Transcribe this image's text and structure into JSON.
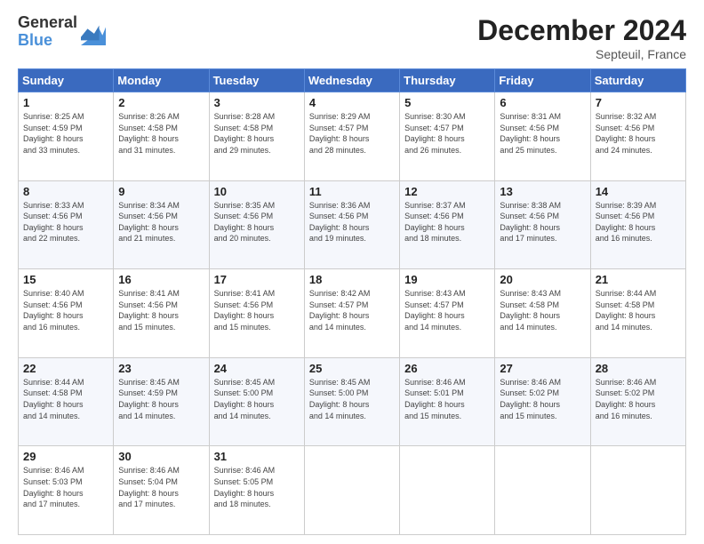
{
  "header": {
    "logo_line1": "General",
    "logo_line2": "Blue",
    "month": "December 2024",
    "location": "Septeuil, France"
  },
  "weekdays": [
    "Sunday",
    "Monday",
    "Tuesday",
    "Wednesday",
    "Thursday",
    "Friday",
    "Saturday"
  ],
  "weeks": [
    [
      {
        "day": "1",
        "lines": [
          "Sunrise: 8:25 AM",
          "Sunset: 4:59 PM",
          "Daylight: 8 hours",
          "and 33 minutes."
        ]
      },
      {
        "day": "2",
        "lines": [
          "Sunrise: 8:26 AM",
          "Sunset: 4:58 PM",
          "Daylight: 8 hours",
          "and 31 minutes."
        ]
      },
      {
        "day": "3",
        "lines": [
          "Sunrise: 8:28 AM",
          "Sunset: 4:58 PM",
          "Daylight: 8 hours",
          "and 29 minutes."
        ]
      },
      {
        "day": "4",
        "lines": [
          "Sunrise: 8:29 AM",
          "Sunset: 4:57 PM",
          "Daylight: 8 hours",
          "and 28 minutes."
        ]
      },
      {
        "day": "5",
        "lines": [
          "Sunrise: 8:30 AM",
          "Sunset: 4:57 PM",
          "Daylight: 8 hours",
          "and 26 minutes."
        ]
      },
      {
        "day": "6",
        "lines": [
          "Sunrise: 8:31 AM",
          "Sunset: 4:56 PM",
          "Daylight: 8 hours",
          "and 25 minutes."
        ]
      },
      {
        "day": "7",
        "lines": [
          "Sunrise: 8:32 AM",
          "Sunset: 4:56 PM",
          "Daylight: 8 hours",
          "and 24 minutes."
        ]
      }
    ],
    [
      {
        "day": "8",
        "lines": [
          "Sunrise: 8:33 AM",
          "Sunset: 4:56 PM",
          "Daylight: 8 hours",
          "and 22 minutes."
        ]
      },
      {
        "day": "9",
        "lines": [
          "Sunrise: 8:34 AM",
          "Sunset: 4:56 PM",
          "Daylight: 8 hours",
          "and 21 minutes."
        ]
      },
      {
        "day": "10",
        "lines": [
          "Sunrise: 8:35 AM",
          "Sunset: 4:56 PM",
          "Daylight: 8 hours",
          "and 20 minutes."
        ]
      },
      {
        "day": "11",
        "lines": [
          "Sunrise: 8:36 AM",
          "Sunset: 4:56 PM",
          "Daylight: 8 hours",
          "and 19 minutes."
        ]
      },
      {
        "day": "12",
        "lines": [
          "Sunrise: 8:37 AM",
          "Sunset: 4:56 PM",
          "Daylight: 8 hours",
          "and 18 minutes."
        ]
      },
      {
        "day": "13",
        "lines": [
          "Sunrise: 8:38 AM",
          "Sunset: 4:56 PM",
          "Daylight: 8 hours",
          "and 17 minutes."
        ]
      },
      {
        "day": "14",
        "lines": [
          "Sunrise: 8:39 AM",
          "Sunset: 4:56 PM",
          "Daylight: 8 hours",
          "and 16 minutes."
        ]
      }
    ],
    [
      {
        "day": "15",
        "lines": [
          "Sunrise: 8:40 AM",
          "Sunset: 4:56 PM",
          "Daylight: 8 hours",
          "and 16 minutes."
        ]
      },
      {
        "day": "16",
        "lines": [
          "Sunrise: 8:41 AM",
          "Sunset: 4:56 PM",
          "Daylight: 8 hours",
          "and 15 minutes."
        ]
      },
      {
        "day": "17",
        "lines": [
          "Sunrise: 8:41 AM",
          "Sunset: 4:56 PM",
          "Daylight: 8 hours",
          "and 15 minutes."
        ]
      },
      {
        "day": "18",
        "lines": [
          "Sunrise: 8:42 AM",
          "Sunset: 4:57 PM",
          "Daylight: 8 hours",
          "and 14 minutes."
        ]
      },
      {
        "day": "19",
        "lines": [
          "Sunrise: 8:43 AM",
          "Sunset: 4:57 PM",
          "Daylight: 8 hours",
          "and 14 minutes."
        ]
      },
      {
        "day": "20",
        "lines": [
          "Sunrise: 8:43 AM",
          "Sunset: 4:58 PM",
          "Daylight: 8 hours",
          "and 14 minutes."
        ]
      },
      {
        "day": "21",
        "lines": [
          "Sunrise: 8:44 AM",
          "Sunset: 4:58 PM",
          "Daylight: 8 hours",
          "and 14 minutes."
        ]
      }
    ],
    [
      {
        "day": "22",
        "lines": [
          "Sunrise: 8:44 AM",
          "Sunset: 4:58 PM",
          "Daylight: 8 hours",
          "and 14 minutes."
        ]
      },
      {
        "day": "23",
        "lines": [
          "Sunrise: 8:45 AM",
          "Sunset: 4:59 PM",
          "Daylight: 8 hours",
          "and 14 minutes."
        ]
      },
      {
        "day": "24",
        "lines": [
          "Sunrise: 8:45 AM",
          "Sunset: 5:00 PM",
          "Daylight: 8 hours",
          "and 14 minutes."
        ]
      },
      {
        "day": "25",
        "lines": [
          "Sunrise: 8:45 AM",
          "Sunset: 5:00 PM",
          "Daylight: 8 hours",
          "and 14 minutes."
        ]
      },
      {
        "day": "26",
        "lines": [
          "Sunrise: 8:46 AM",
          "Sunset: 5:01 PM",
          "Daylight: 8 hours",
          "and 15 minutes."
        ]
      },
      {
        "day": "27",
        "lines": [
          "Sunrise: 8:46 AM",
          "Sunset: 5:02 PM",
          "Daylight: 8 hours",
          "and 15 minutes."
        ]
      },
      {
        "day": "28",
        "lines": [
          "Sunrise: 8:46 AM",
          "Sunset: 5:02 PM",
          "Daylight: 8 hours",
          "and 16 minutes."
        ]
      }
    ],
    [
      {
        "day": "29",
        "lines": [
          "Sunrise: 8:46 AM",
          "Sunset: 5:03 PM",
          "Daylight: 8 hours",
          "and 17 minutes."
        ]
      },
      {
        "day": "30",
        "lines": [
          "Sunrise: 8:46 AM",
          "Sunset: 5:04 PM",
          "Daylight: 8 hours",
          "and 17 minutes."
        ]
      },
      {
        "day": "31",
        "lines": [
          "Sunrise: 8:46 AM",
          "Sunset: 5:05 PM",
          "Daylight: 8 hours",
          "and 18 minutes."
        ]
      },
      null,
      null,
      null,
      null
    ]
  ]
}
